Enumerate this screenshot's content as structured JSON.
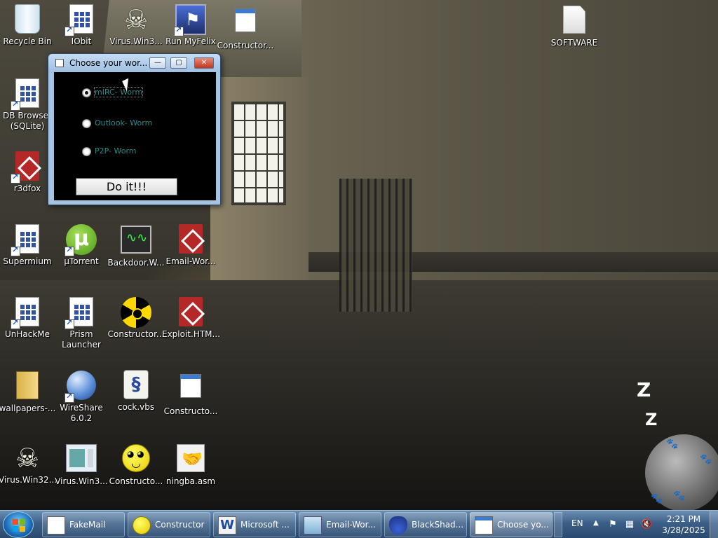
{
  "desktop": {
    "icons": [
      {
        "label": "Recycle Bin",
        "icon": "recycle-bin-icon"
      },
      {
        "label": "IObit",
        "icon": "app-document-icon"
      },
      {
        "label": "Virus.Win3...",
        "icon": "skull-icon"
      },
      {
        "label": "Run MyFelix",
        "icon": "felix-icon"
      },
      {
        "label": "Constructor...",
        "icon": "app-window-icon"
      },
      {
        "label": "SOFTWARE",
        "icon": "blank-file-icon"
      },
      {
        "label": "DB Browser\n(SQLite)",
        "label_line1": "DB Browser",
        "label_line2": "(SQLite)",
        "icon": "app-document-icon"
      },
      {
        "label": "r3dfox",
        "icon": "r3dfox-icon"
      },
      {
        "label": "Supermium",
        "icon": "app-document-icon"
      },
      {
        "label": "µTorrent",
        "icon": "utorrent-icon"
      },
      {
        "label": "Backdoor.W...",
        "icon": "oscilloscope-icon"
      },
      {
        "label": "Email-Wor...",
        "icon": "pdf-icon"
      },
      {
        "label": "UnHackMe",
        "icon": "app-document-icon"
      },
      {
        "label_line1": "Prism",
        "label_line2": "Launcher",
        "icon": "app-document-icon"
      },
      {
        "label": "Constructor...",
        "icon": "radiation-icon"
      },
      {
        "label": "Exploit.HTM...",
        "icon": "pdf-icon"
      },
      {
        "label": "wallpapers-...",
        "icon": "folder-icon"
      },
      {
        "label_line1": "WireShare",
        "label_line2": "6.0.2",
        "icon": "globe-icon"
      },
      {
        "label": "cock.vbs",
        "icon": "script-icon"
      },
      {
        "label": "Constructo...",
        "icon": "app-window-icon"
      },
      {
        "label": "Virus.Win32...",
        "icon": "skull-icon"
      },
      {
        "label": "Virus.Win3...",
        "icon": "virus-window-icon"
      },
      {
        "label": "Constructo...",
        "icon": "smiley-icon"
      },
      {
        "label": "ningba.asm",
        "icon": "asm-file-icon"
      }
    ],
    "sleep_z": [
      "Z",
      "Z"
    ]
  },
  "dialog": {
    "title": "Choose your wor...",
    "minimize": "—",
    "maximize": "▢",
    "close": "✕",
    "options": [
      {
        "label": "mIRC- Worm",
        "checked": true
      },
      {
        "label": "Outlook- Worm",
        "checked": false
      },
      {
        "label": "P2P- Worm",
        "checked": false
      }
    ],
    "action_button": "Do it!!!"
  },
  "taskbar": {
    "tasks": [
      {
        "label": "FakeMail",
        "icon": "fakemail-icon"
      },
      {
        "label": "Constructor",
        "icon": "smiley-icon"
      },
      {
        "label": "Microsoft ...",
        "icon": "word-icon"
      },
      {
        "label": "Email-Wor...",
        "icon": "mail-icon"
      },
      {
        "label": "BlackShad...",
        "icon": "flask-icon"
      },
      {
        "label": "Choose yo...",
        "icon": "window-icon",
        "active": true
      }
    ],
    "tray": {
      "language": "EN",
      "time": "2:21 PM",
      "date": "3/28/2025"
    }
  }
}
